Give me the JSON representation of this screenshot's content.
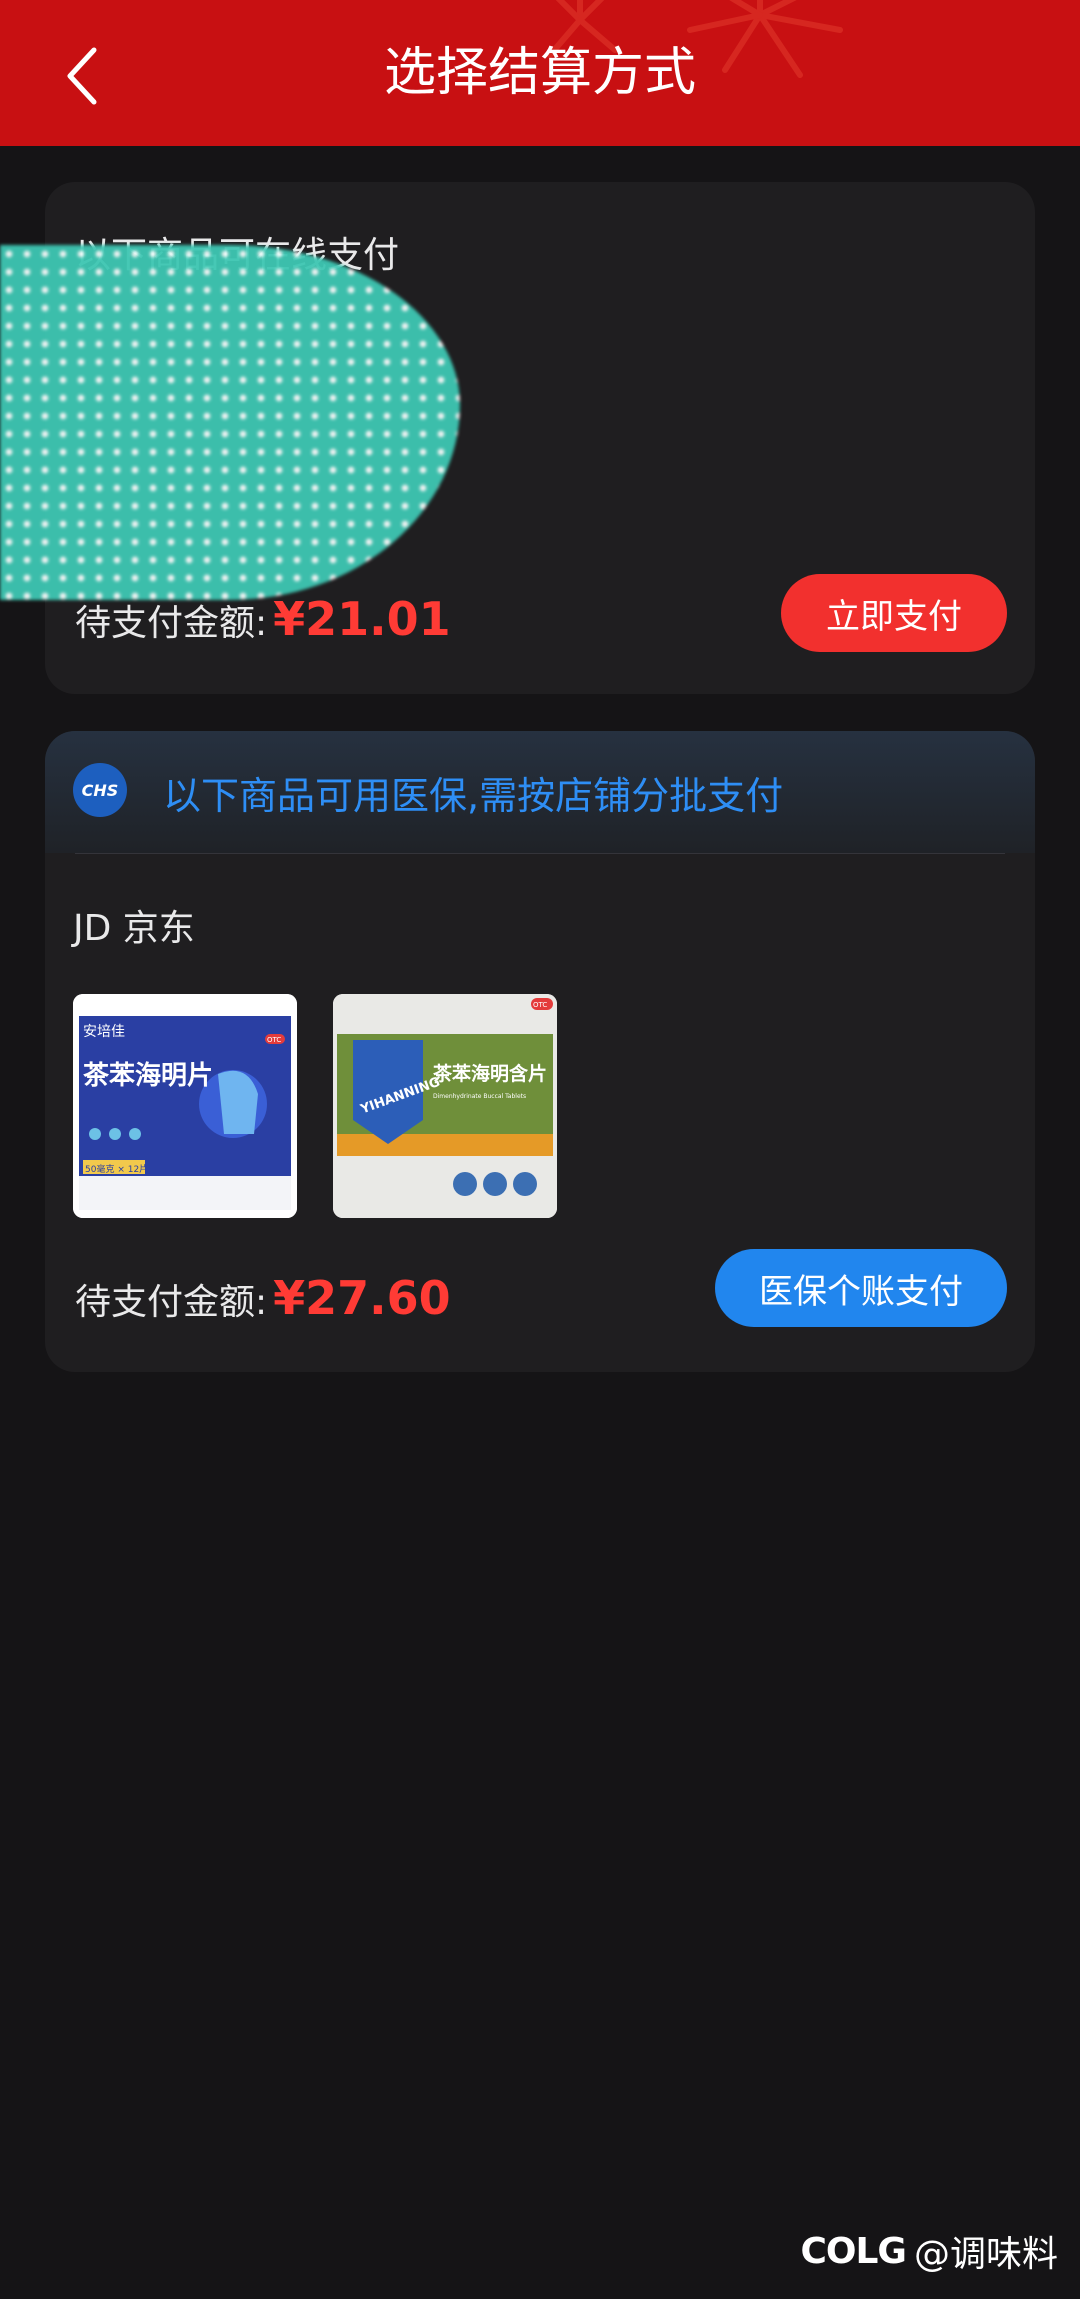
{
  "header": {
    "title": "选择结算方式",
    "back_icon": "chevron-left-icon",
    "color": "#c81012"
  },
  "online_section": {
    "title": "以下商品可在线支付",
    "pending_label": "待支付金额:",
    "amount": "¥21.01",
    "button_label": "立即支付"
  },
  "medical_section": {
    "title": "以下商品可用医保,需按店铺分批支付",
    "logo_text": "CHS",
    "store_name": "JD 京东",
    "products": [
      {
        "brand": "安培佳",
        "name": "茶苯海明片",
        "spec": "50毫克 × 12片",
        "badge": "OTC"
      },
      {
        "brand": "YIHANNING",
        "name": "茶苯海明含片",
        "subtitle": "Dimenhydrinate Buccal Tablets",
        "badge": "OTC"
      }
    ],
    "pending_label": "待支付金额:",
    "amount": "¥27.60",
    "button_label": "医保个账支付"
  },
  "watermark": {
    "brand": "COLG",
    "text": "@调味料"
  },
  "colors": {
    "accent_red": "#ff3b35",
    "button_red": "#f2302e",
    "button_blue": "#2186ee",
    "link_blue": "#2e8ef5"
  }
}
